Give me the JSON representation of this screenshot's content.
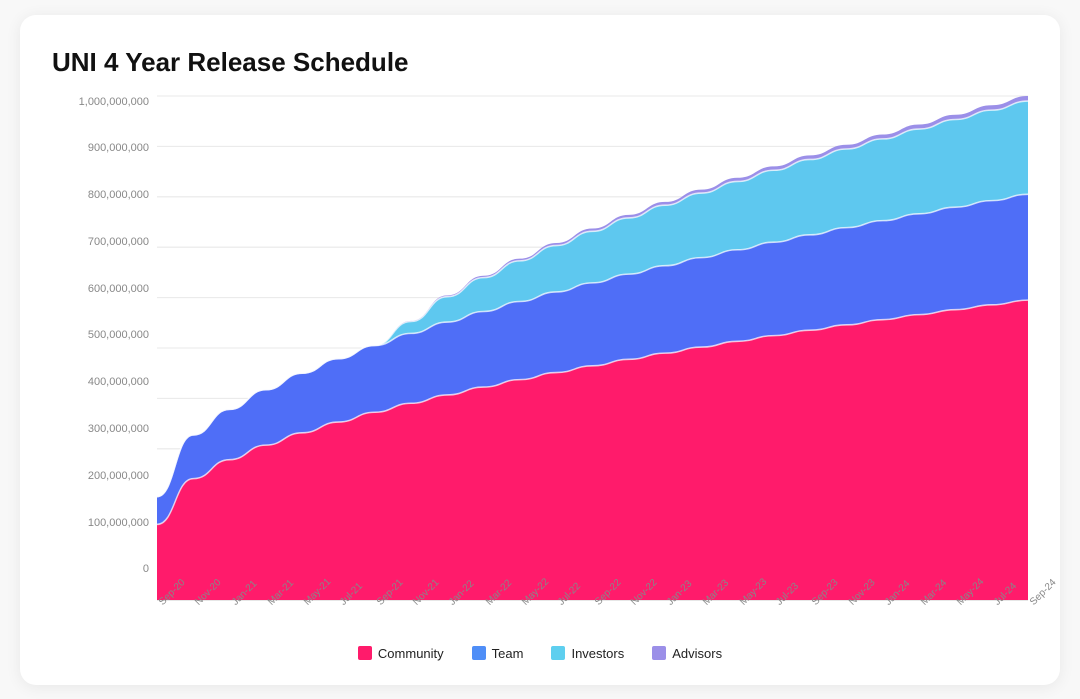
{
  "title": "UNI 4 Year Release Schedule",
  "colors": {
    "community": "#FF1B6B",
    "team": "#4F8EF7",
    "investors": "#5ECFEF",
    "advisors": "#9B8FE8"
  },
  "legend": [
    {
      "key": "community",
      "label": "Community",
      "color": "#FF1B6B"
    },
    {
      "key": "team",
      "label": "Team",
      "color": "#4F8EF7"
    },
    {
      "key": "investors",
      "label": "Investors",
      "color": "#5ECFEF"
    },
    {
      "key": "advisors",
      "label": "Advisors",
      "color": "#9B8FE8"
    }
  ],
  "yAxis": {
    "labels": [
      "1,000,000,000",
      "900,000,000",
      "800,000,000",
      "700,000,000",
      "600,000,000",
      "500,000,000",
      "400,000,000",
      "300,000,000",
      "200,000,000",
      "100,000,000",
      "0"
    ],
    "max": 1000000000
  },
  "xAxis": {
    "labels": [
      "Sep-20",
      "Nov-20",
      "Jan-21",
      "Mar-21",
      "May-21",
      "Jul-21",
      "Sep-21",
      "Nov-21",
      "Jan-22",
      "Mar-22",
      "May-22",
      "Jul-22",
      "Sep-22",
      "Nov-22",
      "Jan-23",
      "Mar-23",
      "May-23",
      "Jul-23",
      "Sep-23",
      "Nov-23",
      "Jan-24",
      "Mar-24",
      "May-24",
      "Jul-24",
      "Sep-24"
    ]
  }
}
